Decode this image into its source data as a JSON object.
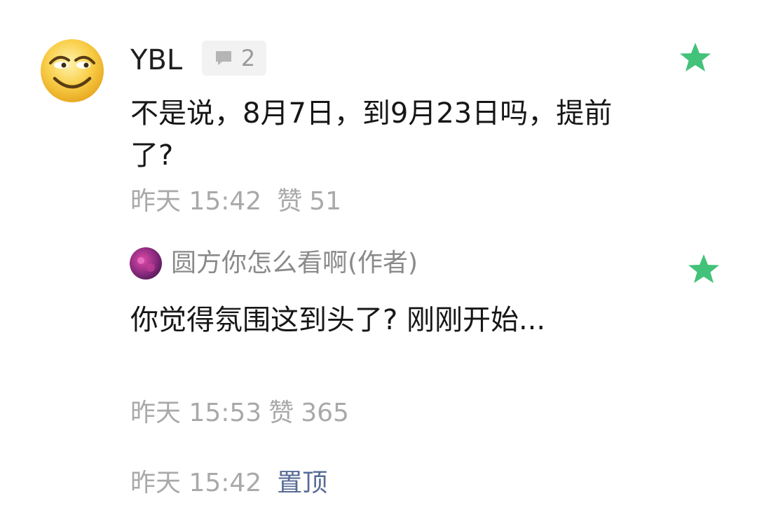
{
  "comment": {
    "username": "YBL",
    "reply_count": "2",
    "text": "不是说，8月7日，到9月23日吗，提前了?",
    "time": "昨天 15:42",
    "like_label": "赞",
    "like_count": "51"
  },
  "reply": {
    "author": "圆方你怎么看啊(作者)",
    "text": "你觉得氛围这到头了? 刚刚开始...",
    "time": "昨天 15:53",
    "like_label": "赞",
    "like_count": "365"
  },
  "footer": {
    "time": "昨天 15:42",
    "pin_label": "置顶"
  },
  "colors": {
    "star": "#43c27a",
    "link": "#576b95",
    "meta": "#a9a9a9"
  },
  "icons": {
    "comment_avatar": "emoji-smirk-avatar",
    "reply_badge": "speech-bubble-icon",
    "favorite": "star-icon",
    "reply_avatar": "purple-avatar"
  }
}
